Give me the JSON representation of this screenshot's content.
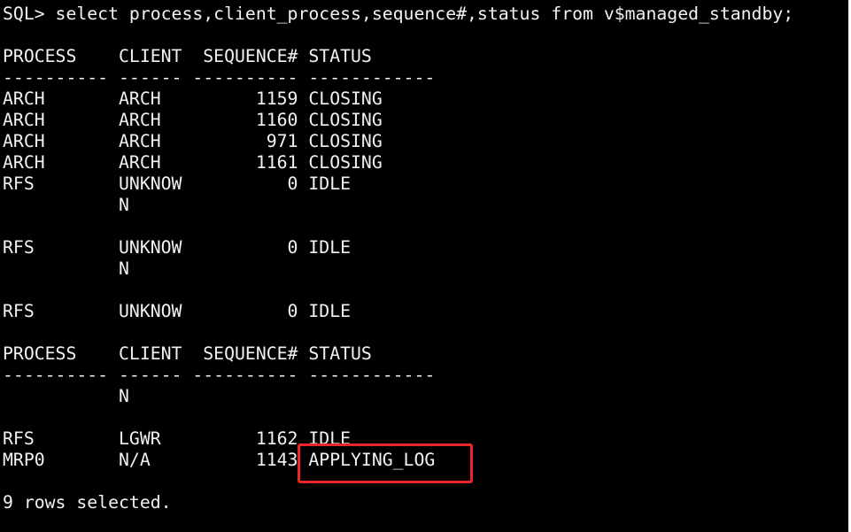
{
  "terminal": {
    "background_color": "#000000",
    "text_color": "#f2f2f2",
    "lines": [
      "SQL> select process,client_process,sequence#,status from v$managed_standby;",
      "",
      "PROCESS    CLIENT  SEQUENCE# STATUS",
      "---------- ------ ---------- ------------",
      "ARCH       ARCH         1159 CLOSING",
      "ARCH       ARCH         1160 CLOSING",
      "ARCH       ARCH          971 CLOSING",
      "ARCH       ARCH         1161 CLOSING",
      "RFS        UNKNOW          0 IDLE",
      "           N",
      "",
      "RFS        UNKNOW          0 IDLE",
      "           N",
      "",
      "RFS        UNKNOW          0 IDLE",
      "",
      "PROCESS    CLIENT  SEQUENCE# STATUS",
      "---------- ------ ---------- ------------",
      "           N",
      "",
      "RFS        LGWR         1162 IDLE",
      "MRP0       N/A          1143 APPLYING_LOG",
      "",
      "9 rows selected."
    ]
  },
  "annotation": {
    "highlighted_text": "APPLYING_LOG",
    "border_color": "#e8262c"
  }
}
